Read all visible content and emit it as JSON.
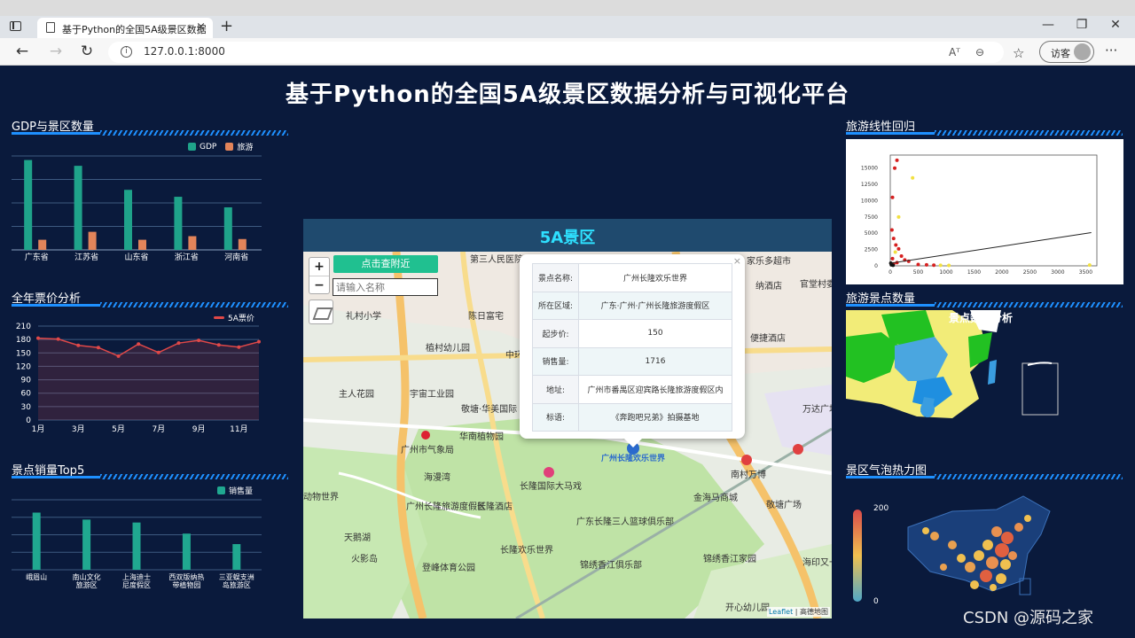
{
  "browser": {
    "tab_title": "基于Python的全国5A级景区数据",
    "tab_close": "×",
    "new_tab": "+",
    "url": "127.0.0.1:8000",
    "guest_label": "访客",
    "window": {
      "minimize": "—",
      "maximize": "❐",
      "close": "✕"
    },
    "icons": {
      "back": "←",
      "forward": "→",
      "reload": "↻",
      "read_aloud": "Aᵀ",
      "zoom": "⊖",
      "favorites": "☆",
      "more": "···"
    }
  },
  "dashboard": {
    "title": "基于Python的全国5A级景区数据分析与可视化平台",
    "panels": {
      "gdp": "GDP与景区数量",
      "ticket": "全年票价分析",
      "sales": "景点销量Top5",
      "regression": "旅游线性回归",
      "count": "旅游景点数量",
      "heat": "景区气泡热力图"
    }
  },
  "map": {
    "header": "5A景区",
    "nearby_button": "点击查附近",
    "name_placeholder": "请输入名称",
    "zoom_in": "+",
    "zoom_out": "−",
    "popup": {
      "close": "×",
      "rows": [
        {
          "key": "景点名称:",
          "value": "广州长隆欢乐世界"
        },
        {
          "key": "所在区域:",
          "value": "广东·广州·广州长隆旅游度假区"
        },
        {
          "key": "起步价:",
          "value": "150"
        },
        {
          "key": "销售量:",
          "value": "1716"
        },
        {
          "key": "地址:",
          "value": "广州市番禺区迎宾路长隆旅游度假区内"
        },
        {
          "key": "标语:",
          "value": "《奔跑吧兄弟》拍摄基地"
        }
      ]
    },
    "place_labels": [
      "第三人民医院",
      "家乐多超市",
      "纳酒店",
      "官堂村委会",
      "礼村小学",
      "陈日富宅",
      "植村幼儿园",
      "便捷酒店",
      "中环",
      "主人花园",
      "宇宙工业园",
      "敬塘·华美国际",
      "万达广场",
      "广州市气象局",
      "华南植物园",
      "广州长隆欢乐世界",
      "海漫湾",
      "长隆国际大马戏",
      "南村万博",
      "金海马商城",
      "敬塘广场",
      "广州长隆旅游度假区",
      "长隆酒店",
      "广东长隆三人篮球俱乐部",
      "长隆欢乐世界",
      "锦绣香江俱乐部",
      "锦绣香江家园",
      "海印又一城",
      "登峰体育公园",
      "开心幼儿园",
      "火影岛",
      "动物世界",
      "天鹅湖"
    ],
    "attribution": {
      "leaflet": "Leaflet",
      "sep": " | ",
      "provider": "高德地图"
    }
  },
  "colors": {
    "gdp": "#1fa38a",
    "tourism": "#e2845a",
    "ticket_line": "#e04848",
    "sales": "#20a890",
    "accent": "#1e90ff",
    "title_cyan": "#2ee0ff"
  },
  "chart_data": [
    {
      "type": "bar",
      "legend": [
        "GDP",
        "旅游"
      ],
      "categories": [
        "广东省",
        "江苏省",
        "山东省",
        "浙江省",
        "河南省"
      ],
      "series": [
        {
          "name": "GDP",
          "values": [
            124369,
            116364,
            83096,
            73516,
            58887
          ]
        },
        {
          "name": "旅游",
          "values": [
            14,
            25,
            14,
            19,
            15
          ]
        }
      ]
    },
    {
      "type": "line",
      "legend": [
        "5A票价"
      ],
      "x": [
        "1月",
        "2月",
        "3月",
        "4月",
        "5月",
        "6月",
        "7月",
        "8月",
        "9月",
        "10月",
        "11月",
        "12月"
      ],
      "x_tick_labels": [
        "1月",
        "3月",
        "5月",
        "7月",
        "9月",
        "11月"
      ],
      "series": [
        {
          "name": "5A票价",
          "values": [
            183,
            181,
            167,
            162,
            143,
            170,
            151,
            172,
            178,
            168,
            163,
            175
          ]
        }
      ],
      "ylim": [
        0,
        210
      ],
      "y_ticks": [
        0,
        30,
        60,
        90,
        120,
        150,
        180,
        210
      ]
    },
    {
      "type": "bar",
      "legend": [
        "销售量"
      ],
      "categories": [
        "峨眉山",
        "南山文化旅游区",
        "上海迪士尼度假区",
        "西双版纳热带植物园",
        "三亚蜈支洲岛旅游区"
      ],
      "category_labels": [
        [
          "峨眉山"
        ],
        [
          "南山文化",
          "旅游区"
        ],
        [
          "上海迪士",
          "尼度假区"
        ],
        [
          "西双版纳热",
          "带植物园"
        ],
        [
          "三亚蜈支洲",
          "岛旅游区"
        ]
      ],
      "series": [
        {
          "name": "销售量",
          "values": [
            98000,
            86000,
            81000,
            62000,
            44000
          ]
        }
      ]
    },
    {
      "type": "scatter",
      "x_ticks": [
        0,
        500,
        1000,
        1500,
        2000,
        2500,
        3000,
        3500
      ],
      "y_ticks": [
        0,
        2500,
        5000,
        7500,
        10000,
        12500,
        15000
      ],
      "points": [
        {
          "x": 120,
          "y": 16200,
          "c": "red"
        },
        {
          "x": 80,
          "y": 15000,
          "c": "red"
        },
        {
          "x": 400,
          "y": 13500,
          "c": "yellow"
        },
        {
          "x": 40,
          "y": 10500,
          "c": "red"
        },
        {
          "x": 150,
          "y": 7500,
          "c": "yellow"
        },
        {
          "x": 30,
          "y": 5500,
          "c": "red"
        },
        {
          "x": 60,
          "y": 4200,
          "c": "red"
        },
        {
          "x": 100,
          "y": 3200,
          "c": "red"
        },
        {
          "x": 150,
          "y": 2600,
          "c": "red"
        },
        {
          "x": 90,
          "y": 2100,
          "c": "yellow"
        },
        {
          "x": 200,
          "y": 1500,
          "c": "red"
        },
        {
          "x": 40,
          "y": 1100,
          "c": "red"
        },
        {
          "x": 260,
          "y": 900,
          "c": "red"
        },
        {
          "x": 330,
          "y": 700,
          "c": "red"
        },
        {
          "x": 120,
          "y": 500,
          "c": "red"
        },
        {
          "x": 60,
          "y": 300,
          "c": "red"
        },
        {
          "x": 500,
          "y": 200,
          "c": "red"
        },
        {
          "x": 650,
          "y": 150,
          "c": "red"
        },
        {
          "x": 780,
          "y": 100,
          "c": "red"
        },
        {
          "x": 900,
          "y": 80,
          "c": "yellow"
        },
        {
          "x": 1050,
          "y": 60,
          "c": "yellow"
        },
        {
          "x": 3570,
          "y": 120,
          "c": "yellow"
        },
        {
          "x": 20,
          "y": 150,
          "c": "black"
        },
        {
          "x": 50,
          "y": 80,
          "c": "black"
        },
        {
          "x": 10,
          "y": 400,
          "c": "black"
        }
      ],
      "fit_line": [
        {
          "x": 0,
          "y": 400
        },
        {
          "x": 3600,
          "y": 5100
        }
      ]
    },
    {
      "type": "heatmap",
      "visual_map": {
        "max": "200",
        "min": "0"
      }
    }
  ],
  "watermark": "CSDN @源码之家",
  "province_map_title": "景点数量分析"
}
